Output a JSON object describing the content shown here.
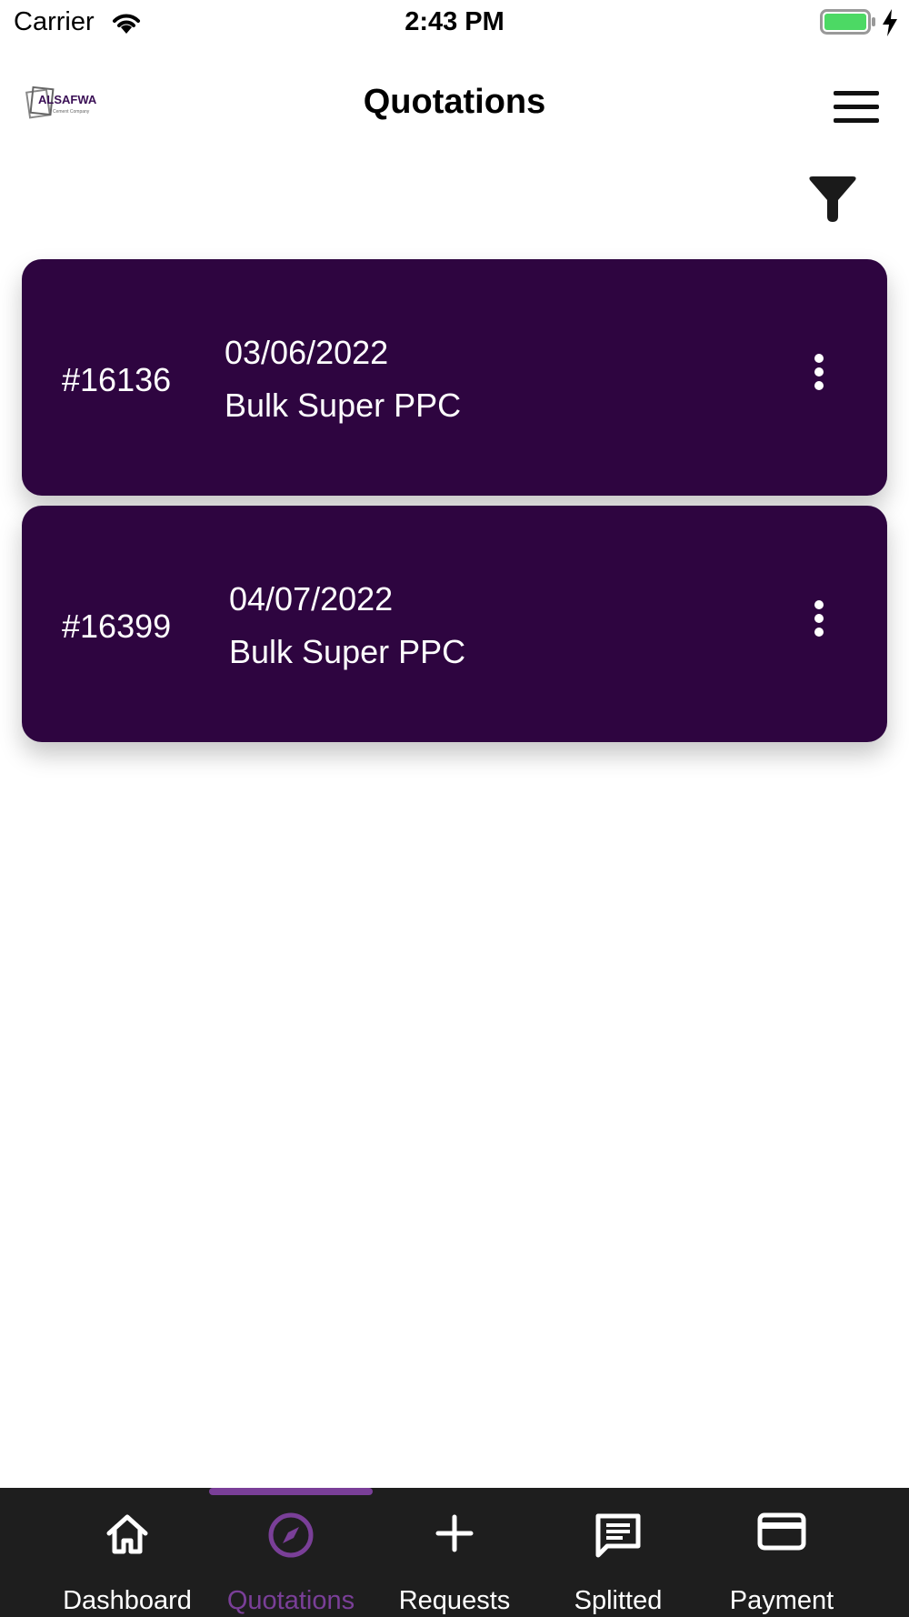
{
  "status_bar": {
    "carrier": "Carrier",
    "time": "2:43 PM",
    "battery_color": "#4cd964"
  },
  "header": {
    "logo_text": "ALSAFWA",
    "logo_subtext": "Cement Company",
    "title": "Quotations"
  },
  "quotations": [
    {
      "id": "#16136",
      "date": "03/06/2022",
      "product": "Bulk Super PPC"
    },
    {
      "id": "#16399",
      "date": "04/07/2022",
      "product": "Bulk Super PPC"
    }
  ],
  "nav": {
    "active": "Quotations",
    "items": [
      {
        "label": "Dashboard",
        "icon": "home-icon"
      },
      {
        "label": "Quotations",
        "icon": "compass-icon"
      },
      {
        "label": "Requests",
        "icon": "plus-icon"
      },
      {
        "label": "Splitted",
        "icon": "message-icon"
      },
      {
        "label": "Payment",
        "icon": "credit-card-icon"
      }
    ]
  },
  "colors": {
    "card_bg": "#2e0540",
    "accent": "#7a3f98",
    "nav_bg": "#1e1e1e"
  }
}
